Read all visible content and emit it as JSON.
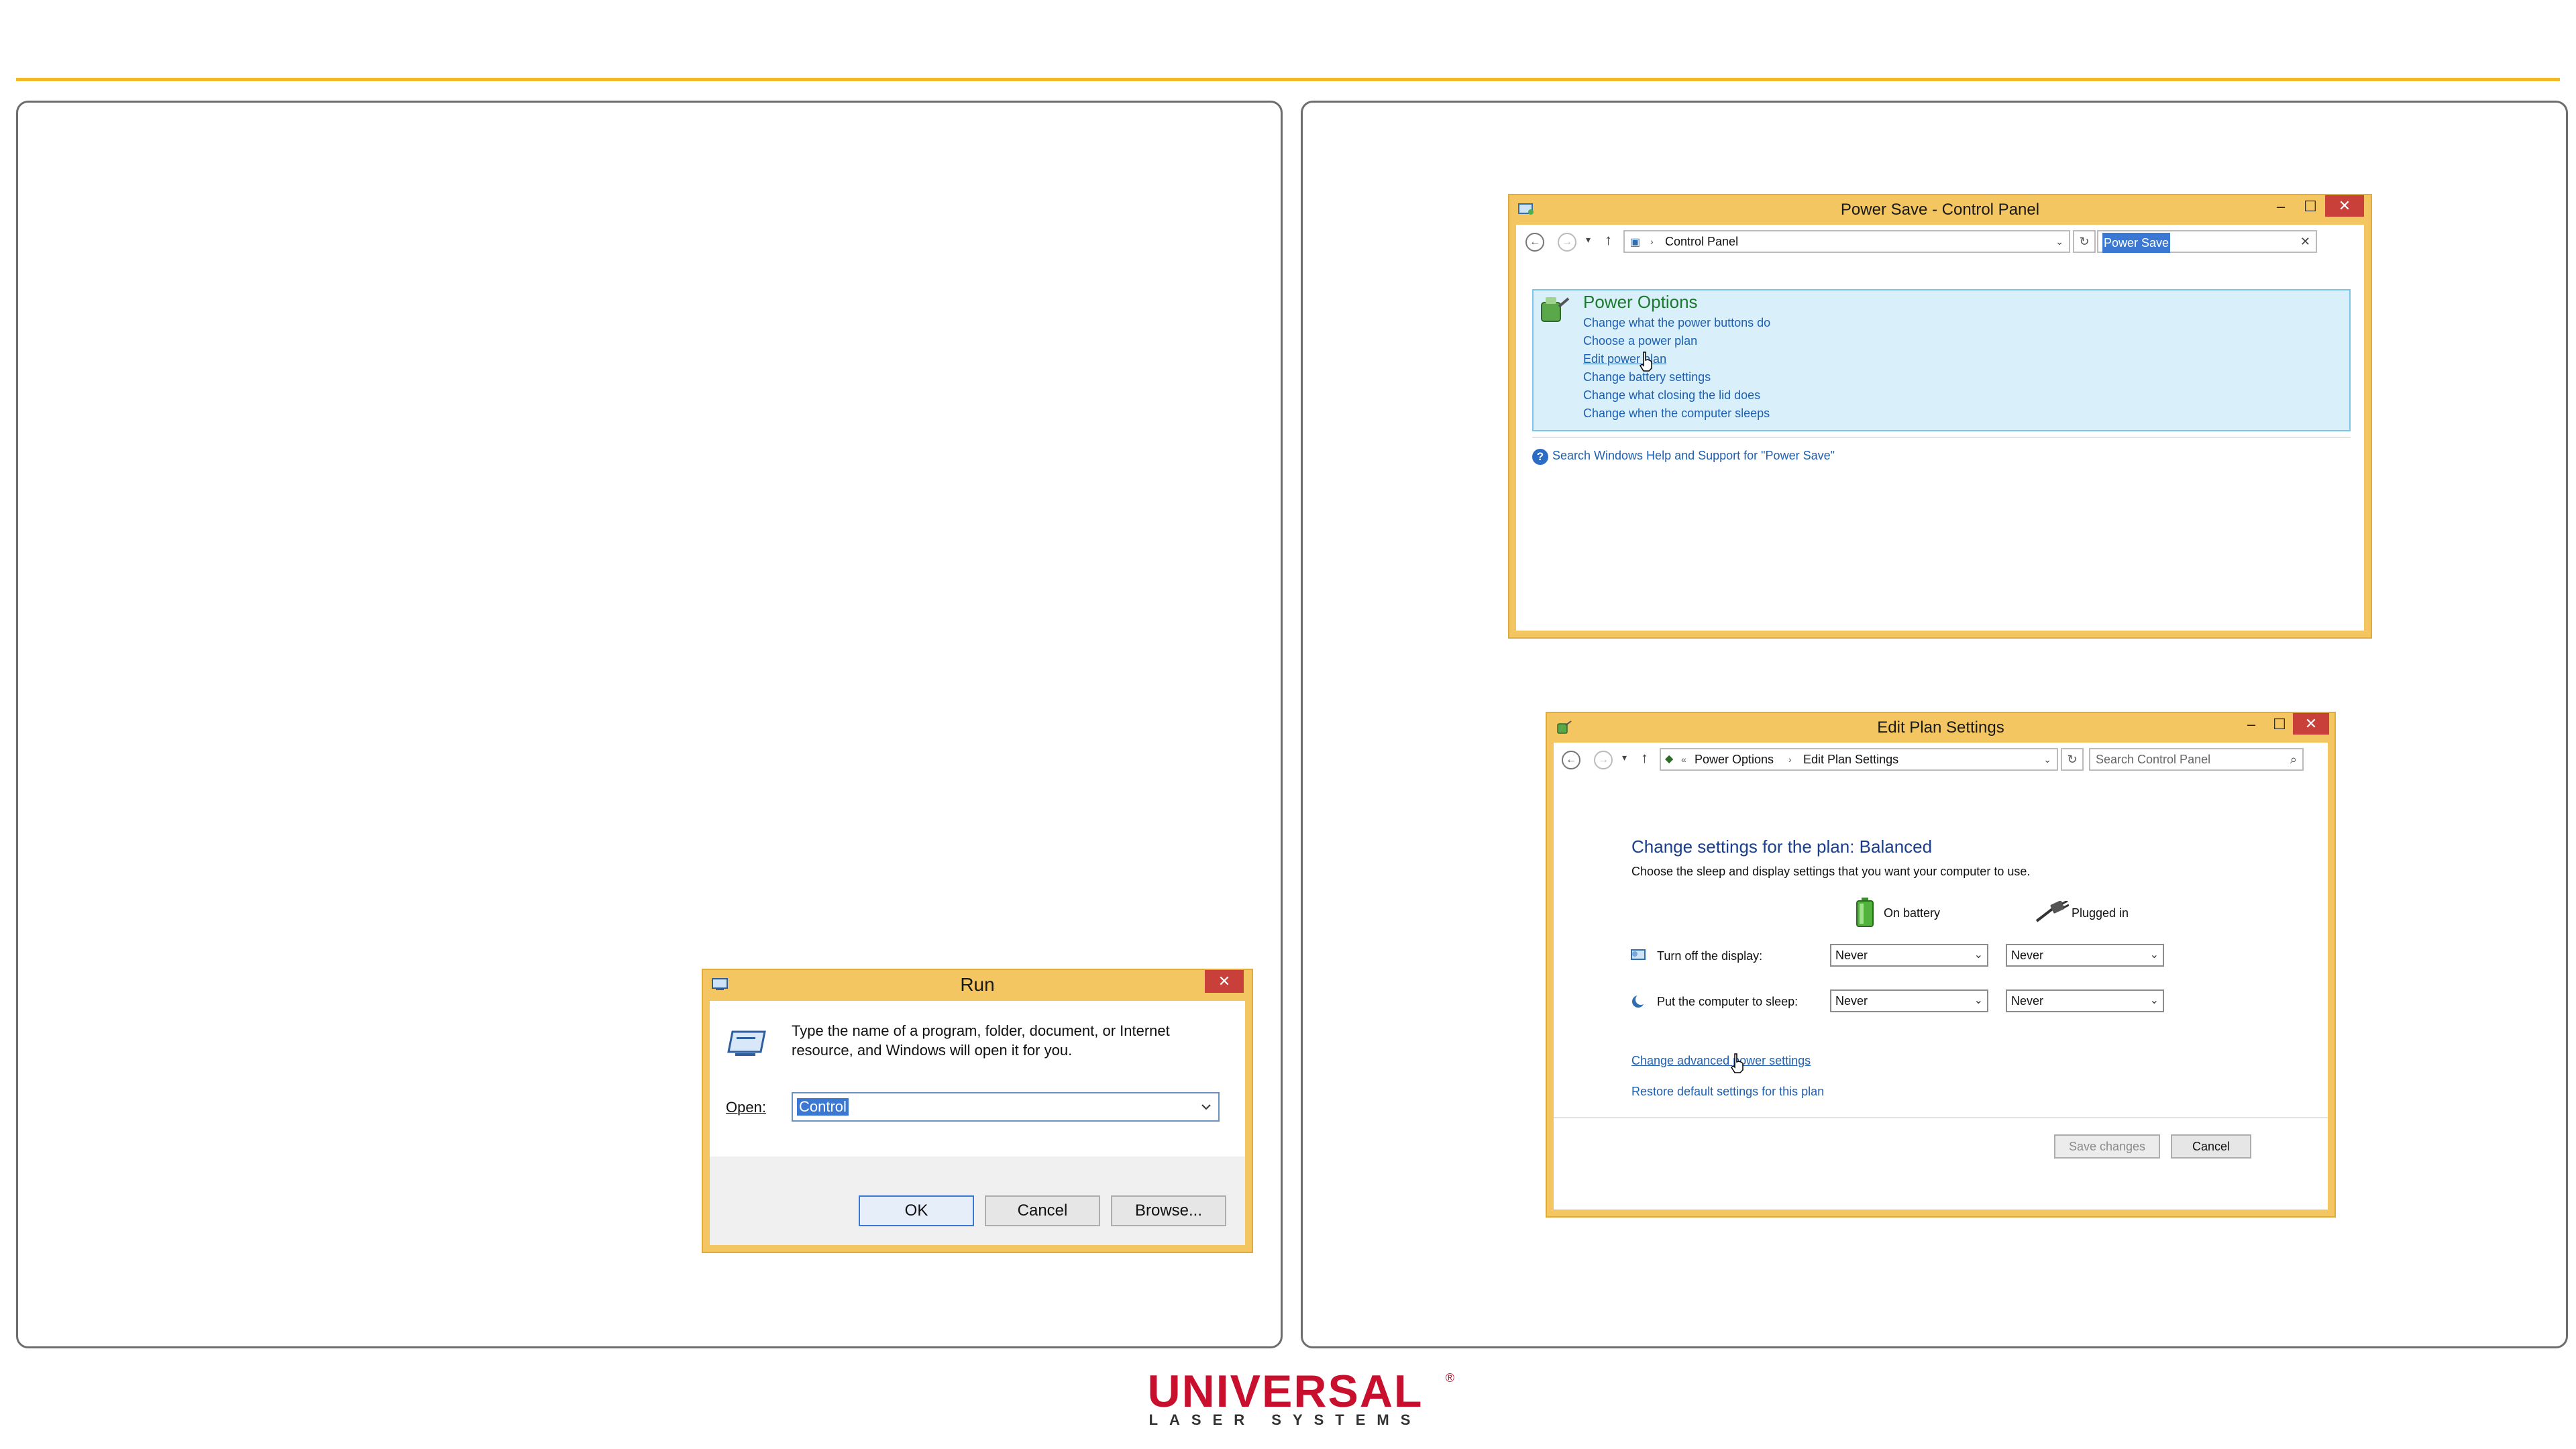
{
  "run_dialog": {
    "title": "Run",
    "close_glyph": "✕",
    "description": "Type the name of a program, folder, document, or Internet resource, and Windows will open it for you.",
    "open_label": "Open:",
    "open_value": "Control",
    "ok": "OK",
    "cancel": "Cancel",
    "browse": "Browse..."
  },
  "control_panel": {
    "title": "Power Save - Control Panel",
    "breadcrumb": "Control Panel",
    "search_value": "Power Save",
    "result_title": "Power Options",
    "links": [
      "Change what the power buttons do",
      "Choose a power plan",
      "Edit power plan",
      "Change battery settings",
      "Change what closing the lid does",
      "Change when the computer sleeps"
    ],
    "help_link": "Search Windows Help and Support for \"Power Save\""
  },
  "edit_plan": {
    "title": "Edit Plan Settings",
    "breadcrumb_root": "Power Options",
    "breadcrumb_leaf": "Edit Plan Settings",
    "search_placeholder": "Search Control Panel",
    "heading": "Change settings for the plan: Balanced",
    "subheading": "Choose the sleep and display settings that you want your computer to use.",
    "on_battery": "On battery",
    "plugged_in": "Plugged in",
    "display_label": "Turn off the display:",
    "sleep_label": "Put the computer to sleep:",
    "display_battery": "Never",
    "display_plugged": "Never",
    "sleep_battery": "Never",
    "sleep_plugged": "Never",
    "advanced_link": "Change advanced power settings",
    "restore_link": "Restore default settings for this plan",
    "save_button": "Save changes",
    "cancel_button": "Cancel"
  },
  "logo": {
    "line1": "UNIVERSAL",
    "line2": "LASER SYSTEMS",
    "registered": "®",
    "color": "#c8102e"
  }
}
